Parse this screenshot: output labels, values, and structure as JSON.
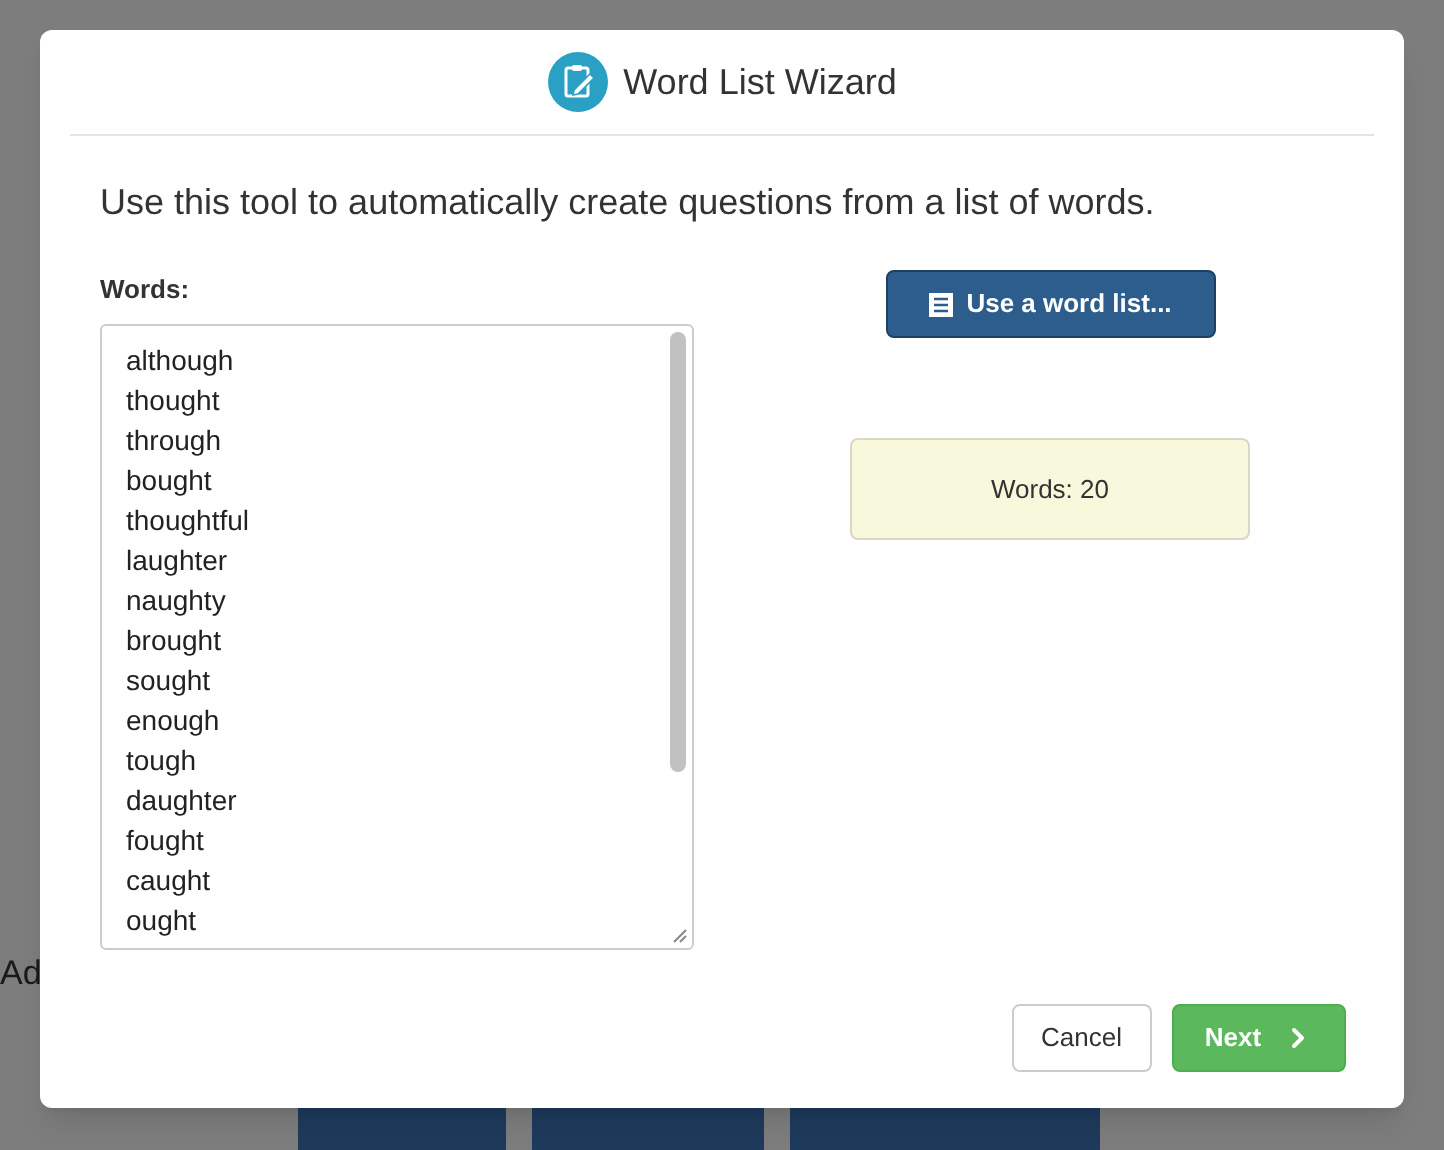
{
  "background": {
    "heading": "Ad"
  },
  "dialog": {
    "title": "Word List Wizard",
    "intro": "Use this tool to automatically create questions from a list of words.",
    "words_label": "Words:",
    "words": [
      "although",
      "thought",
      "through",
      "bought",
      "thoughtful",
      "laughter",
      "naughty",
      "brought",
      "sought",
      "enough",
      "tough",
      "daughter",
      "fought",
      "caught",
      "ought"
    ],
    "word_list_button": "Use a word list...",
    "word_count": "Words: 20",
    "buttons": [
      {
        "kind": "cancel",
        "label": "Cancel"
      },
      {
        "kind": "next",
        "label": "Next"
      }
    ]
  }
}
